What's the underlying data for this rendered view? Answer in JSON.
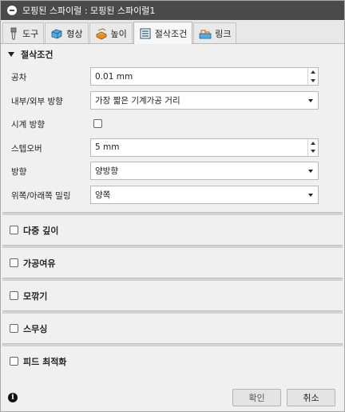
{
  "window": {
    "title": "모핑된 스파이럴 : 모핑된 스파이럴1"
  },
  "tabs": [
    {
      "label": "도구",
      "icon": "tool-icon"
    },
    {
      "label": "형상",
      "icon": "geometry-icon"
    },
    {
      "label": "높이",
      "icon": "height-icon"
    },
    {
      "label": "절삭조건",
      "icon": "passes-icon"
    },
    {
      "label": "링크",
      "icon": "linking-icon"
    }
  ],
  "section": {
    "title": "절삭조건"
  },
  "fields": {
    "tolerance": {
      "label": "공차",
      "value": "0.01 mm"
    },
    "direction_in_out": {
      "label": "내부/외부 방향",
      "value": "가장 짧은 기계가공 거리"
    },
    "clockwise": {
      "label": "시계 방향",
      "checked": false
    },
    "stepover": {
      "label": "스텝오버",
      "value": "5 mm"
    },
    "direction": {
      "label": "방향",
      "value": "양방향"
    },
    "up_down_milling": {
      "label": "위쪽/아래쪽 밀링",
      "value": "양쪽"
    }
  },
  "groups": [
    {
      "label": "다중 깊이",
      "checked": false
    },
    {
      "label": "가공여유",
      "checked": false
    },
    {
      "label": "모깎기",
      "checked": false
    },
    {
      "label": "스무싱",
      "checked": false
    },
    {
      "label": "피드 최적화",
      "checked": false
    }
  ],
  "footer": {
    "ok_label": "확인",
    "cancel_label": "취소"
  }
}
